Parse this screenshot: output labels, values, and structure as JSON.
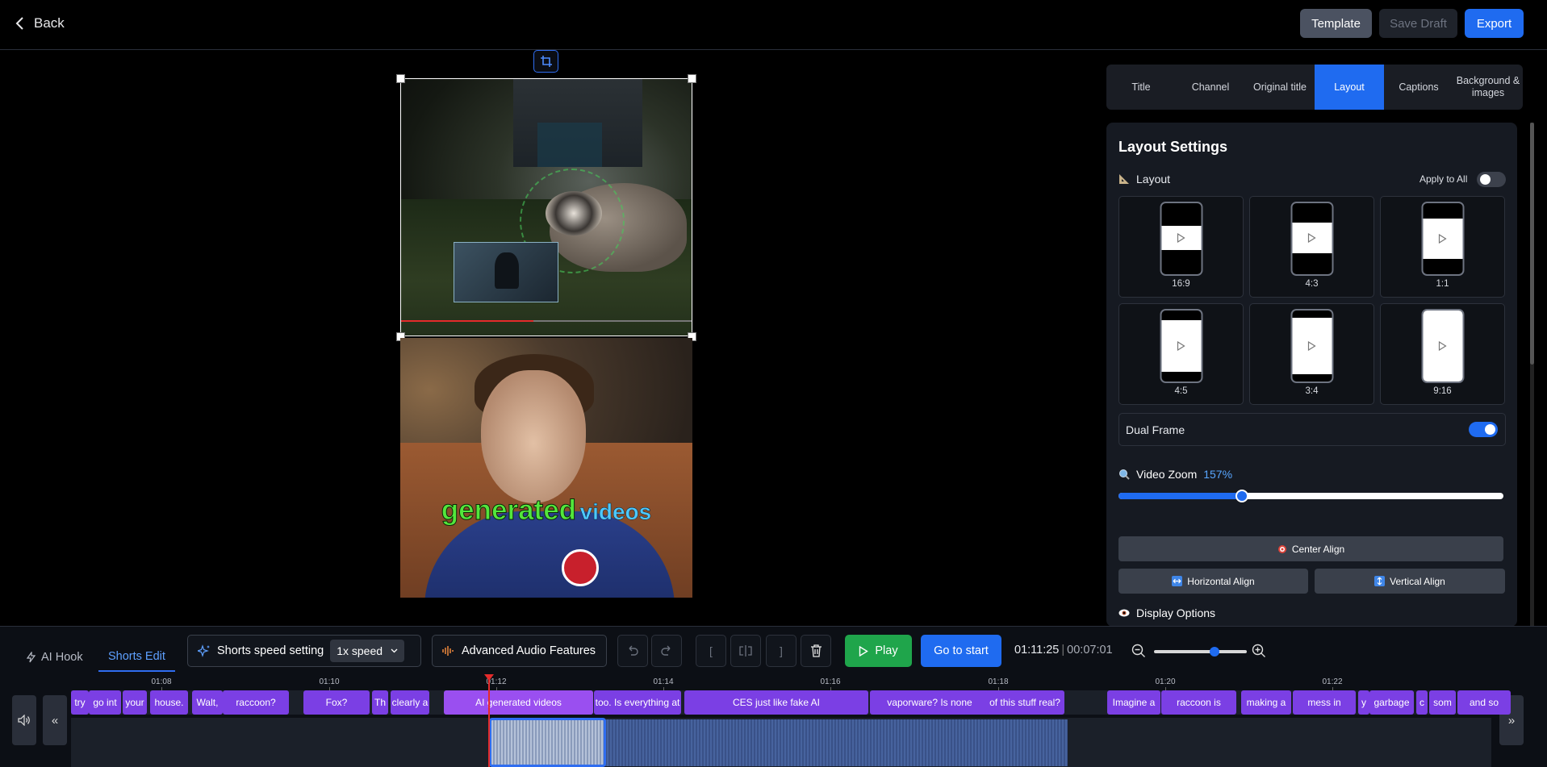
{
  "topbar": {
    "back_label": "Back",
    "template_label": "Template",
    "save_draft_label": "Save Draft",
    "export_label": "Export"
  },
  "preview": {
    "caption_word_1": "generated",
    "caption_word_2": "videos"
  },
  "tabs": [
    {
      "label": "Title"
    },
    {
      "label": "Channel"
    },
    {
      "label": "Original title"
    },
    {
      "label": "Layout",
      "active": true
    },
    {
      "label": "Captions"
    },
    {
      "label": "Background & images"
    }
  ],
  "settings": {
    "title": "Layout Settings",
    "layout_label": "Layout",
    "apply_to_all_label": "Apply to All",
    "apply_to_all_on": false,
    "layouts": [
      {
        "label": "16:9"
      },
      {
        "label": "4:3"
      },
      {
        "label": "1:1"
      },
      {
        "label": "4:5"
      },
      {
        "label": "3:4"
      },
      {
        "label": "9:16"
      }
    ],
    "dual_frame_label": "Dual Frame",
    "dual_frame_on": true,
    "video_zoom_label": "Video Zoom",
    "video_zoom_value": "157%",
    "video_zoom_fraction": 0.32,
    "center_align_label": "Center Align",
    "horizontal_align_label": "Horizontal Align",
    "vertical_align_label": "Vertical Align",
    "display_options_label": "Display Options"
  },
  "toolbar": {
    "ai_hook_label": "AI Hook",
    "shorts_edit_label": "Shorts Edit",
    "speed_setting_label": "Shorts speed setting",
    "speed_value": "1x speed",
    "audio_features_label": "Advanced Audio Features",
    "bracket_open": "[",
    "bracket_close": "]",
    "play_label": "Play",
    "go_to_start_label": "Go to start",
    "current_time": "01:11:25",
    "total_time": "00:07:01",
    "timeline_zoom_fraction": 0.65
  },
  "timeline": {
    "ticks": [
      "01:08",
      "01:10",
      "01:12",
      "01:14",
      "01:16",
      "01:18",
      "01:20",
      "01:22"
    ],
    "clips": [
      "try",
      "go int",
      "your",
      "house.",
      "Walt,",
      "raccoon?",
      "Fox?",
      "Th",
      "clearly a",
      "AI generated videos",
      "too. Is everything at",
      "CES just like fake AI",
      "vaporware? Is none",
      "of this stuff real?",
      "Imagine a",
      "raccoon is",
      "making a",
      "mess in",
      "y",
      "garbage",
      "c",
      "som",
      "and so"
    ],
    "left_nav": "«",
    "right_nav": "»"
  },
  "colors": {
    "accent": "#1f6bf0",
    "play_green": "#1fa54b",
    "clip_purple": "#7b3fe4",
    "playhead_red": "#e52b2b"
  }
}
